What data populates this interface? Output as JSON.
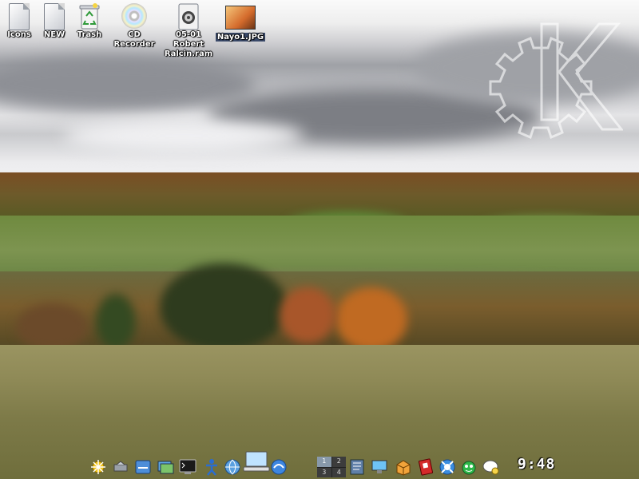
{
  "desktop": {
    "icons": [
      {
        "label": "Icons"
      },
      {
        "label": "NEW"
      },
      {
        "label": "Trash"
      },
      {
        "label": "CD Recorder"
      },
      {
        "label_line1": "05-01 Robert",
        "label_line2": "Ralcin.ram"
      },
      {
        "label": "Nayo1.JPG"
      }
    ]
  },
  "taskbar": {
    "pager": [
      "1",
      "2",
      "3",
      "4"
    ],
    "clock": "9:48"
  },
  "colors": {
    "label_text": "#ffffff",
    "label_shadow": "#000000"
  }
}
